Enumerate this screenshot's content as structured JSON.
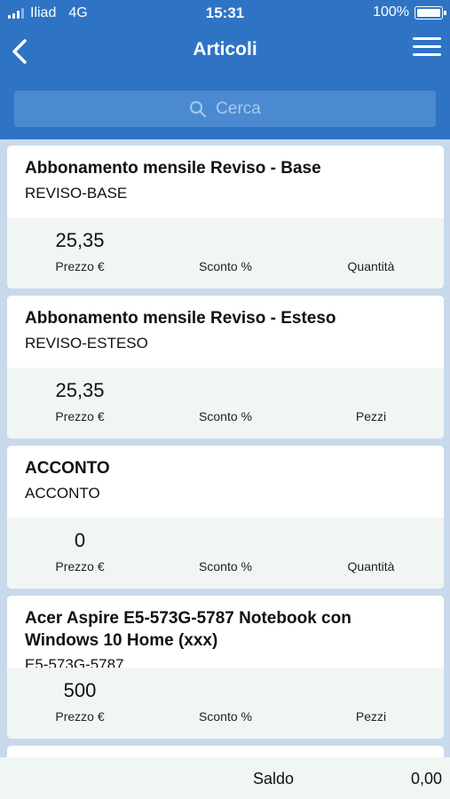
{
  "status_bar": {
    "carrier": "Iliad",
    "network": "4G",
    "time": "15:31",
    "battery": "100%"
  },
  "nav": {
    "title": "Articoli"
  },
  "search": {
    "placeholder": "Cerca"
  },
  "items": [
    {
      "title": "Abbonamento mensile Reviso - Base",
      "code": "REVISO-BASE",
      "price": "25,35",
      "price_label": "Prezzo €",
      "discount_label": "Sconto %",
      "unit_label": "Quantità"
    },
    {
      "title": "Abbonamento mensile Reviso - Esteso",
      "code": "REVISO-ESTESO",
      "price": "25,35",
      "price_label": "Prezzo €",
      "discount_label": "Sconto %",
      "unit_label": "Pezzi"
    },
    {
      "title": "ACCONTO",
      "code": "ACCONTO",
      "price": "0",
      "price_label": "Prezzo €",
      "discount_label": "Sconto %",
      "unit_label": "Quantità"
    },
    {
      "title": "Acer Aspire E5-573G-5787 Notebook con Windows 10 Home (xxx)",
      "code": "E5-573G-5787",
      "price": "500",
      "price_label": "Prezzo €",
      "discount_label": "Sconto %",
      "unit_label": "Pezzi"
    }
  ],
  "footer": {
    "label": "Saldo",
    "value": "0,00"
  },
  "colors": {
    "header": "#2f74c4",
    "background": "#c9d9ec",
    "card_bottom": "#f1f6f3"
  }
}
